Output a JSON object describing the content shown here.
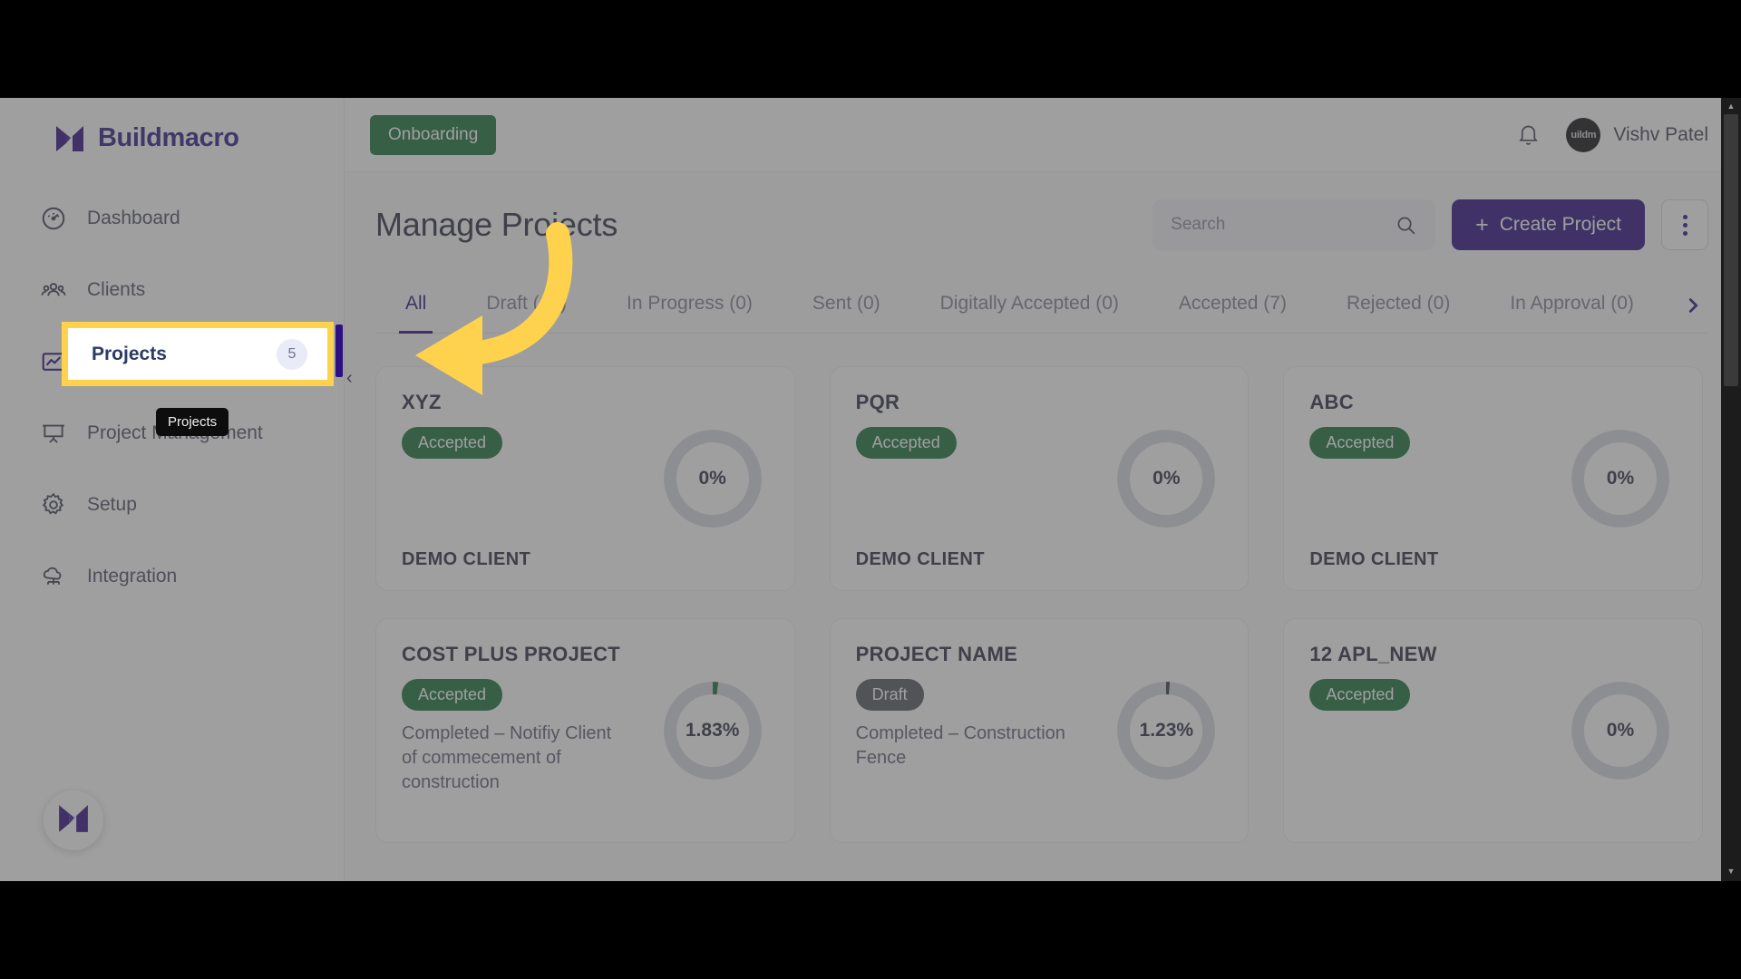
{
  "brand": {
    "name": "Buildmacro",
    "logo_icon": "buildmacro-m-logo"
  },
  "sidebar": {
    "items": [
      {
        "label": "Dashboard",
        "icon": "speedometer-icon",
        "badge": null
      },
      {
        "label": "Clients",
        "icon": "users-group-icon",
        "badge": null
      },
      {
        "label": "Projects",
        "icon": "chart-box-icon",
        "badge": "5"
      },
      {
        "label": "Project Management",
        "icon": "presentation-board-icon",
        "badge": null
      },
      {
        "label": "Setup",
        "icon": "gear-icon",
        "badge": null
      },
      {
        "label": "Integration",
        "icon": "cloud-network-icon",
        "badge": null
      }
    ],
    "collapse_icon": "chevron-left-icon",
    "bottom_logo_icon": "buildmacro-m-logo"
  },
  "topbar": {
    "onboarding_label": "Onboarding",
    "bell_icon": "bell-icon",
    "avatar_text": "uildm",
    "user_name": "Vishv Patel"
  },
  "page": {
    "title": "Manage Projects",
    "search": {
      "placeholder": "Search",
      "value": "",
      "icon": "search-icon"
    },
    "create_button": {
      "label": "Create Project",
      "icon": "plus-icon"
    },
    "more_button_icon": "vertical-dots-icon"
  },
  "tabs": {
    "items": [
      {
        "label": "All",
        "active": true
      },
      {
        "label": "Draft (10)",
        "active": false
      },
      {
        "label": "In Progress (0)",
        "active": false
      },
      {
        "label": "Sent (0)",
        "active": false
      },
      {
        "label": "Digitally Accepted (0)",
        "active": false
      },
      {
        "label": "Accepted (7)",
        "active": false
      },
      {
        "label": "Rejected (0)",
        "active": false
      },
      {
        "label": "In Approval (0)",
        "active": false
      }
    ],
    "next_icon": "chevron-right-icon"
  },
  "cards": [
    {
      "name": "XYZ",
      "status": "Accepted",
      "status_kind": "accepted",
      "subtitle": "",
      "client": "DEMO CLIENT",
      "percent": "0%",
      "percent_value": 0
    },
    {
      "name": "PQR",
      "status": "Accepted",
      "status_kind": "accepted",
      "subtitle": "",
      "client": "DEMO CLIENT",
      "percent": "0%",
      "percent_value": 0
    },
    {
      "name": "ABC",
      "status": "Accepted",
      "status_kind": "accepted",
      "subtitle": "",
      "client": "DEMO CLIENT",
      "percent": "0%",
      "percent_value": 0
    },
    {
      "name": "COST PLUS PROJECT",
      "status": "Accepted",
      "status_kind": "accepted",
      "subtitle": "Completed – Notifiy Client of commecement of construction",
      "client": "",
      "percent": "1.83%",
      "percent_value": 1.83
    },
    {
      "name": "PROJECT NAME",
      "status": "Draft",
      "status_kind": "draft",
      "subtitle": "Completed – Construction Fence",
      "client": "",
      "percent": "1.23%",
      "percent_value": 1.23
    },
    {
      "name": "12 APL_NEW",
      "status": "Accepted",
      "status_kind": "accepted",
      "subtitle": "",
      "client": "",
      "percent": "0%",
      "percent_value": 0
    }
  ],
  "annotation": {
    "highlight_label": "Projects",
    "highlight_badge": "5",
    "tooltip_text": "Projects",
    "arrow_icon": "curved-arrow-left",
    "highlight_color": "#ffd24d"
  },
  "colors": {
    "brand_purple": "#2d0f82",
    "accent_green": "#18713a",
    "draft_grey": "#55575f",
    "highlight_yellow": "#ffd24d"
  }
}
